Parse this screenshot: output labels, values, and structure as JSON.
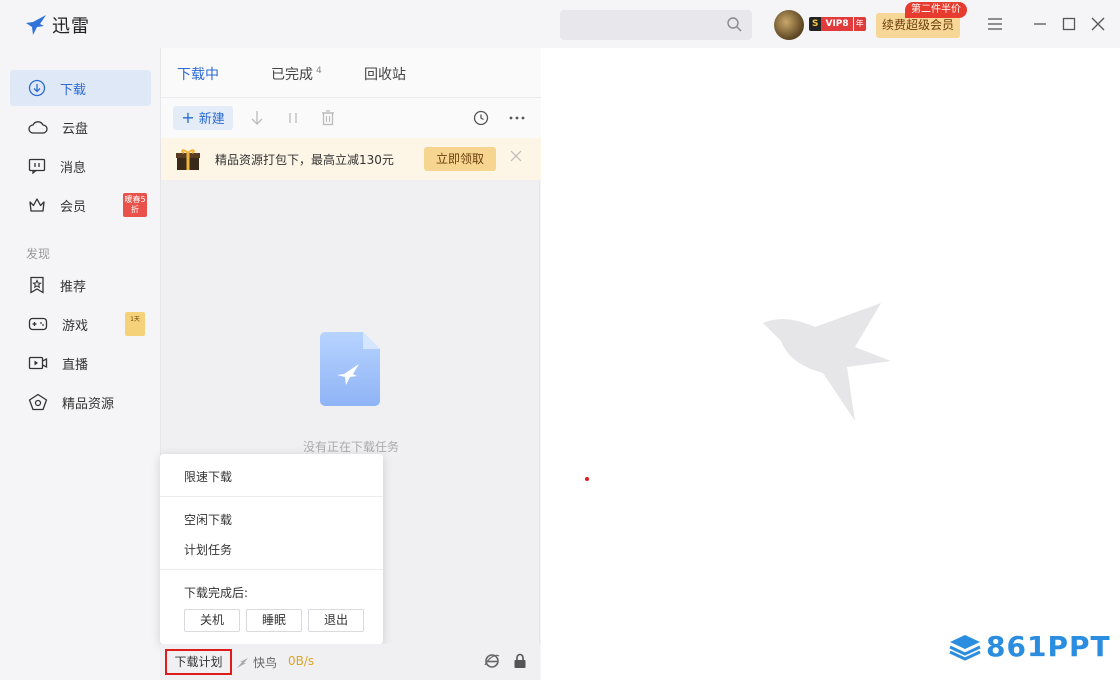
{
  "app": {
    "title": "迅雷"
  },
  "header": {
    "search_placeholder": "",
    "vip_s": "S",
    "vip_label": "VIP8",
    "vip_year": "年",
    "renew_label": "续费超级会员",
    "promo_tag": "第二件半价"
  },
  "sidebar": {
    "items": [
      {
        "label": "下载",
        "icon": "download-icon"
      },
      {
        "label": "云盘",
        "icon": "cloud-icon"
      },
      {
        "label": "消息",
        "icon": "message-icon"
      },
      {
        "label": "会员",
        "icon": "crown-icon"
      }
    ],
    "vip_badge": "暖春5折",
    "section": "发现",
    "discover": [
      {
        "label": "推荐",
        "icon": "star-icon"
      },
      {
        "label": "游戏",
        "icon": "gamepad-icon"
      },
      {
        "label": "直播",
        "icon": "live-icon"
      },
      {
        "label": "精品资源",
        "icon": "diamond-icon"
      }
    ],
    "game_badge": "1天"
  },
  "tabs": [
    {
      "label": "下载中",
      "active": true
    },
    {
      "label": "已完成",
      "count": "4"
    },
    {
      "label": "回收站"
    }
  ],
  "toolbar": {
    "new_label": "新建"
  },
  "promo": {
    "text": "精品资源打包下，最高立减130元",
    "button": "立即领取"
  },
  "empty": {
    "text": "没有正在下载任务"
  },
  "popup": {
    "limit_speed": "限速下载",
    "idle_download": "空闲下载",
    "scheduled_task": "计划任务",
    "after_complete": "下载完成后:",
    "buttons": [
      "关机",
      "睡眠",
      "退出"
    ]
  },
  "statusbar": {
    "schedule": "下载计划",
    "kuainiao": "快鸟",
    "speed": "0B/s"
  },
  "watermark": {
    "text": "861PPT"
  },
  "colors": {
    "accent": "#2c6bd4",
    "promo": "#f6d591",
    "highlight": "#e01b1b"
  }
}
